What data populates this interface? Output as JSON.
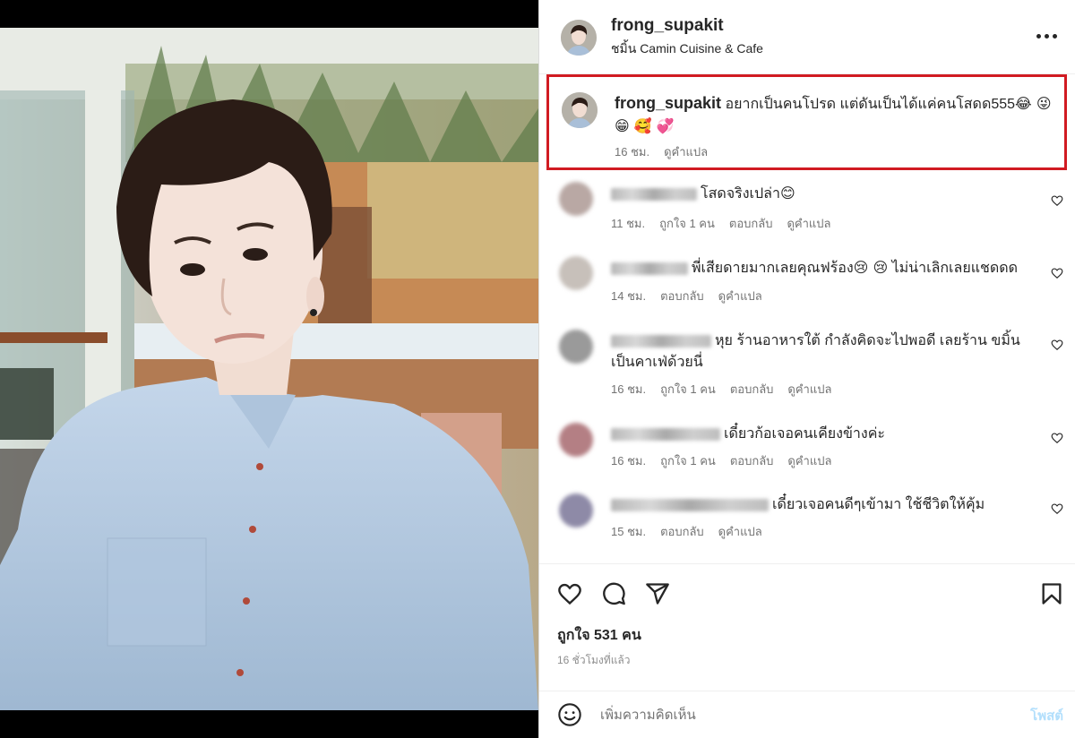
{
  "post": {
    "username": "frong_supakit",
    "location": "ชมิ้น Camin Cuisine & Cafe",
    "more_icon": "more-horizontal-icon"
  },
  "caption": {
    "username": "frong_supakit",
    "text": "อยากเป็นคนโปรด แต่ดันเป็นได้แค่คนโสดด555",
    "emojis": "😂 😜 😁 🥰 💞",
    "time": "16 ชม.",
    "translate": "ดูคำแปล"
  },
  "comments": [
    {
      "text": "โสดจริงเปล่า",
      "emoji": "😊",
      "time": "11 ชม.",
      "likes": "ถูกใจ 1 คน",
      "reply": "ตอบกลับ",
      "translate": "ดูคำแปล",
      "avatar_color": "#b9a8a4"
    },
    {
      "text": "พี่เสียดายมากเลยคุณฟร้อง",
      "emoji": "😢 😢",
      "text_after": "ไม่น่าเลิกเลยแชดดด",
      "time": "14 ชม.",
      "likes": "",
      "reply": "ตอบกลับ",
      "translate": "ดูคำแปล",
      "avatar_color": "#c7c0ba"
    },
    {
      "text": "หุย ร้านอาหารใต้ กำลังคิดจะไปพอดี เลยร้าน ขมิ้น",
      "text_line2": "เป็นคาเฟ่ด้วยนี่",
      "time": "16 ชม.",
      "likes": "ถูกใจ 1 คน",
      "reply": "ตอบกลับ",
      "translate": "ดูคำแปล",
      "avatar_color": "#9a9a9a"
    },
    {
      "text": "เดี๋ยวก้อเจอคนเคียงข้างค่ะ",
      "time": "16 ชม.",
      "likes": "ถูกใจ 1 คน",
      "reply": "ตอบกลับ",
      "translate": "ดูคำแปล",
      "avatar_color": "#b47f84"
    },
    {
      "text": "เดี๋ยวเจอคนดีๆเข้ามา ใช้ชีวิตให้คุ้ม",
      "time": "15 ชม.",
      "likes": "",
      "reply": "ตอบกลับ",
      "translate": "ดูคำแปล",
      "avatar_color": "#8e8aa7"
    }
  ],
  "actions": {
    "like_icon": "heart-icon",
    "comment_icon": "comment-icon",
    "share_icon": "share-icon",
    "save_icon": "bookmark-icon",
    "likes_label": "ถูกใจ 531 คน",
    "posted_ago": "16 ชั่วโมงที่แล้ว"
  },
  "add_comment": {
    "emoji_icon": "smiley-icon",
    "placeholder": "เพิ่มความคิดเห็น",
    "post_label": "โพสต์"
  },
  "colors": {
    "highlight_border": "#d11b22",
    "post_button": "#b2dffc",
    "meta_text": "#737373"
  }
}
